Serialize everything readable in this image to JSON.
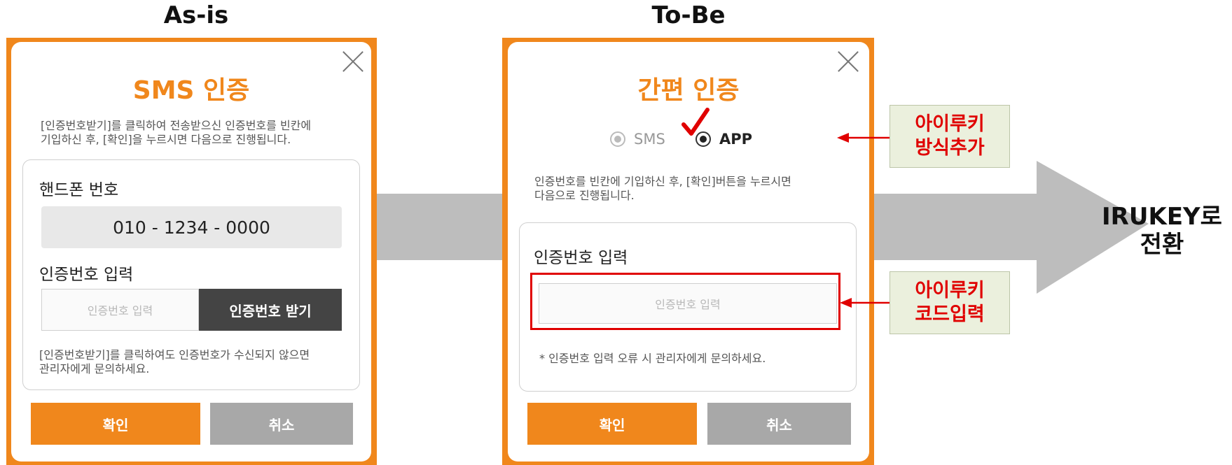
{
  "headings": {
    "as_is": "As-is",
    "to_be": "To-Be"
  },
  "as_is": {
    "title": "SMS 인증",
    "description_line1": "[인증번호받기]를 클릭하여 전송받으신 인증번호를 빈칸에",
    "description_line2": "기입하신 후, [확인]을 누르시면 다음으로 진행됩니다.",
    "phone_label": "핸드폰 번호",
    "phone_value": "010 - 1234 - 0000",
    "code_label": "인증번호 입력",
    "code_placeholder": "인증번호 입력",
    "get_code_button": "인증번호 받기",
    "note_line1": "[인증번호받기]를 클릭하여도 인증번호가 수신되지 않으면",
    "note_line2": "관리자에게 문의하세요.",
    "confirm_button": "확인",
    "cancel_button": "취소"
  },
  "to_be": {
    "title": "간편 인증",
    "radio_sms": "SMS",
    "radio_app": "APP",
    "selected_method": "APP",
    "description_line1": "인증번호를 빈칸에 기입하신 후, [확인]버튼을 누르시면",
    "description_line2": "다음으로 진행됩니다.",
    "code_label": "인증번호 입력",
    "code_placeholder": "인증번호 입력",
    "note": "* 인증번호 입력 오류 시 관리자에게 문의하세요.",
    "confirm_button": "확인",
    "cancel_button": "취소"
  },
  "callouts": {
    "method_line1": "아이루키",
    "method_line2": "방식추가",
    "code_line1": "아이루키",
    "code_line2": "코드입력"
  },
  "result": {
    "line1": "IRUKEY로",
    "line2": "전환"
  },
  "icons": [
    "close-icon",
    "check-mark-icon",
    "arrow-left-icon",
    "big-right-arrow"
  ],
  "colors": {
    "accent": "#f0871c",
    "highlight": "#e00000",
    "callout_bg": "#ebf0dd",
    "button_dark": "#444444",
    "button_gray": "#a8a8a8"
  }
}
